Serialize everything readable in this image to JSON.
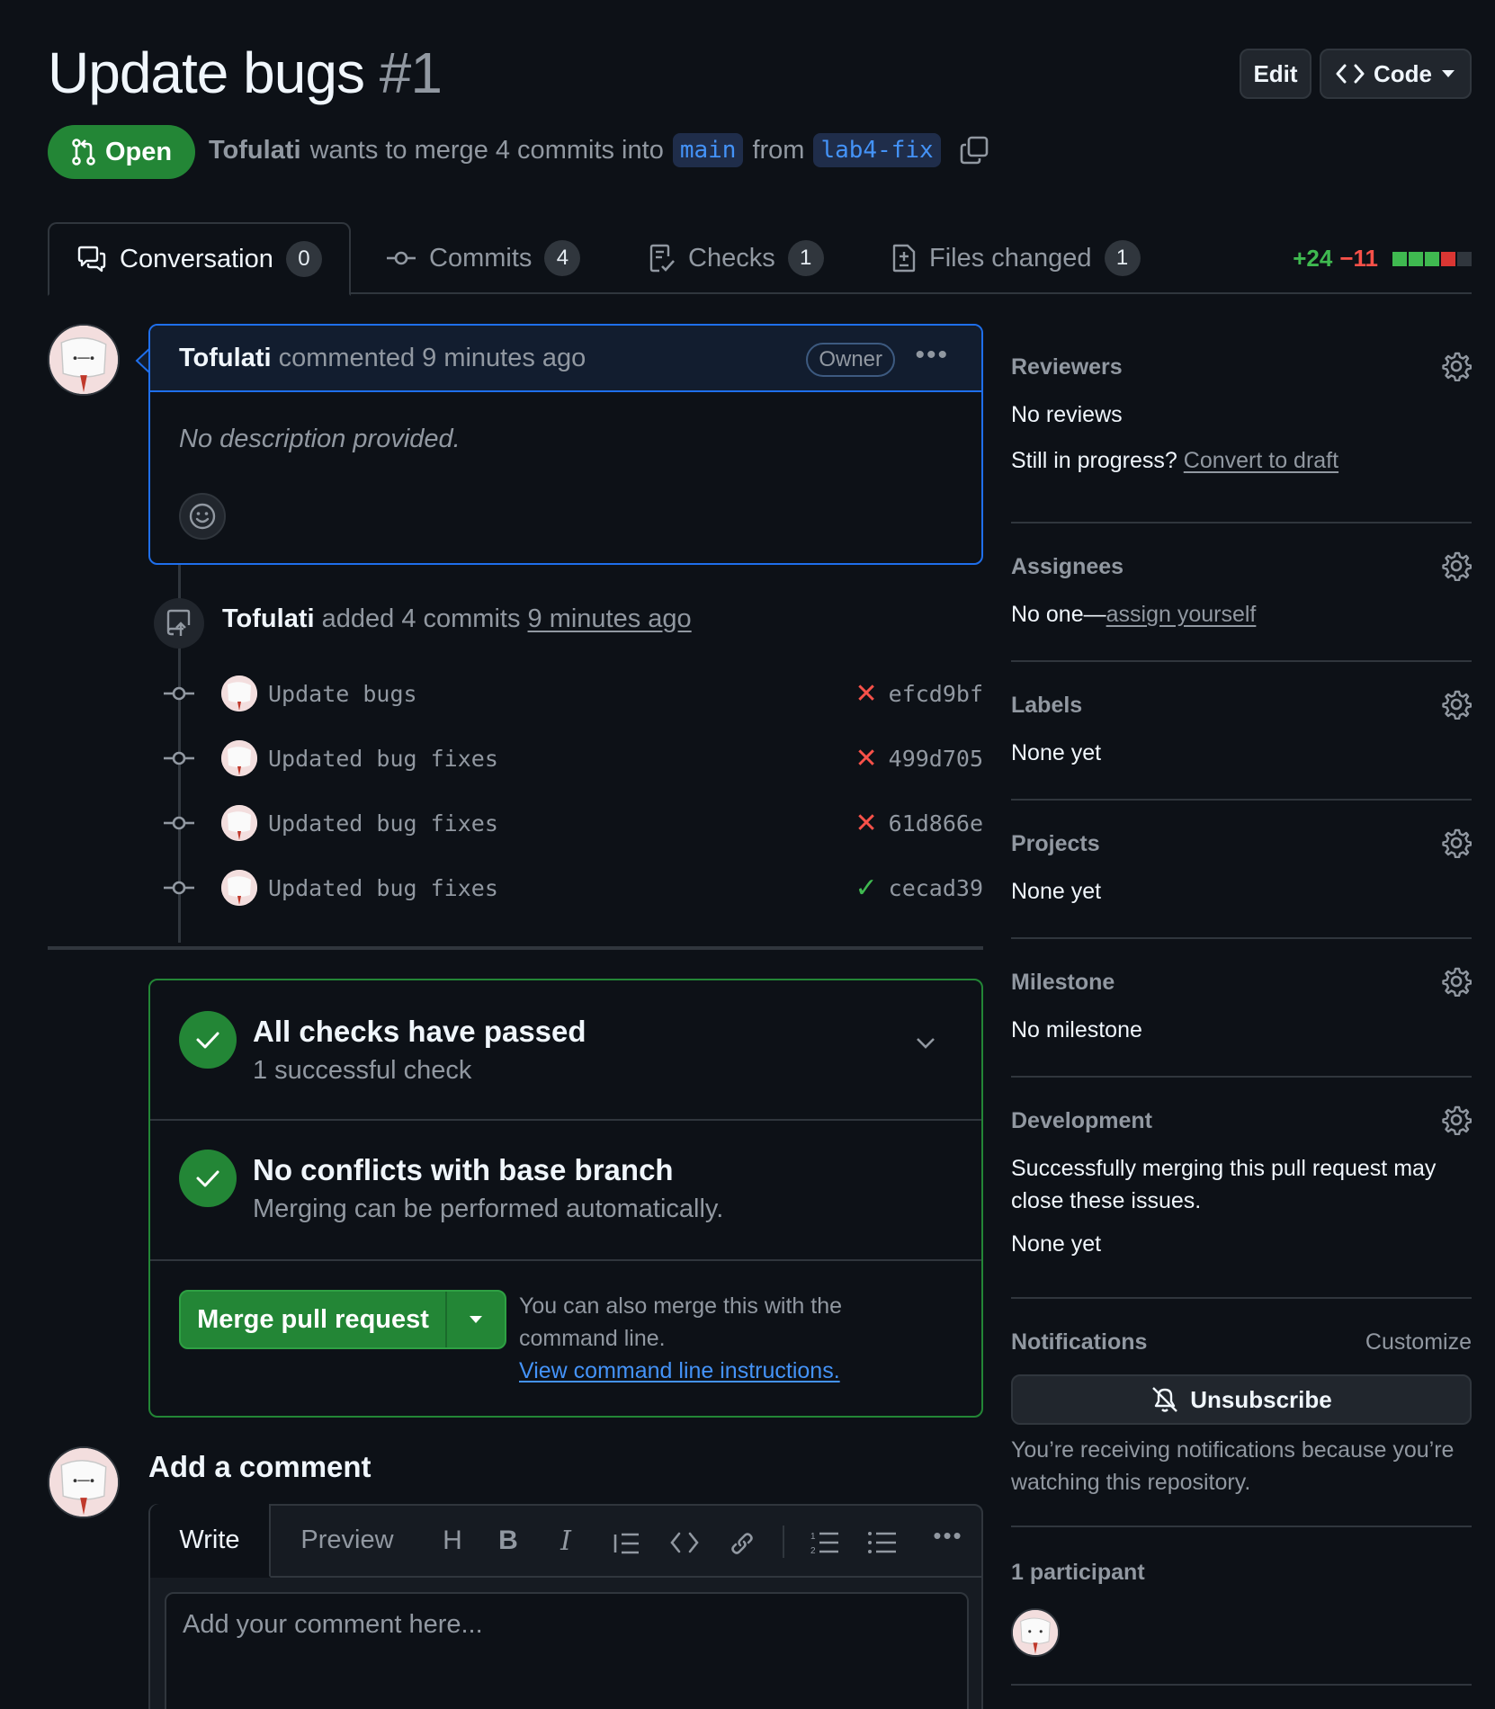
{
  "header": {
    "title": "Update bugs",
    "number": "#1",
    "edit_label": "Edit",
    "code_label": "Code",
    "state": "Open",
    "author": "Tofulati",
    "meta_text": "wants to merge 4 commits into",
    "base_branch": "main",
    "from_text": "from",
    "head_branch": "lab4-fix"
  },
  "tabs": [
    {
      "label": "Conversation",
      "count": "0",
      "icon": "comment-discussion-icon"
    },
    {
      "label": "Commits",
      "count": "4",
      "icon": "git-commit-icon"
    },
    {
      "label": "Checks",
      "count": "1",
      "icon": "checklist-icon"
    },
    {
      "label": "Files changed",
      "count": "1",
      "icon": "file-diff-icon"
    }
  ],
  "diffstat": {
    "additions": "+24",
    "deletions": "−11",
    "blocks": [
      "green",
      "green",
      "green",
      "red",
      "gray"
    ],
    "colors": {
      "green": "#3fb950",
      "red": "#da3633",
      "gray": "#30363d"
    }
  },
  "comment": {
    "author": "Tofulati",
    "action": "commented 9 minutes ago",
    "role": "Owner",
    "body": "No description provided."
  },
  "timeline": {
    "author": "Tofulati",
    "action": "added 4 commits",
    "time": "9 minutes ago",
    "commits": [
      {
        "message": "Update bugs",
        "sha": "efcd9bf",
        "status": "fail"
      },
      {
        "message": "Updated bug fixes",
        "sha": "499d705",
        "status": "fail"
      },
      {
        "message": "Updated bug fixes",
        "sha": "61d866e",
        "status": "fail"
      },
      {
        "message": "Updated bug fixes",
        "sha": "cecad39",
        "status": "pass"
      }
    ]
  },
  "merge": {
    "checks_title": "All checks have passed",
    "checks_sub": "1 successful check",
    "conflicts_title": "No conflicts with base branch",
    "conflicts_sub": "Merging can be performed automatically.",
    "merge_button": "Merge pull request",
    "hint": "You can also merge this with the command line.",
    "hint_link": "View command line instructions."
  },
  "add_comment": {
    "title": "Add a comment",
    "write_tab": "Write",
    "preview_tab": "Preview",
    "placeholder": "Add your comment here..."
  },
  "sidebar": {
    "reviewers": {
      "title": "Reviewers",
      "value": "No reviews",
      "progress_text": "Still in progress?",
      "progress_link": "Convert to draft"
    },
    "assignees": {
      "title": "Assignees",
      "value": "No one—",
      "link": "assign yourself"
    },
    "labels": {
      "title": "Labels",
      "value": "None yet"
    },
    "projects": {
      "title": "Projects",
      "value": "None yet"
    },
    "milestone": {
      "title": "Milestone",
      "value": "No milestone"
    },
    "development": {
      "title": "Development",
      "text": "Successfully merging this pull request may close these issues.",
      "value": "None yet"
    },
    "notifications": {
      "title": "Notifications",
      "customize": "Customize",
      "button": "Unsubscribe",
      "note": "You’re receiving notifications because you’re watching this repository."
    },
    "participants": {
      "title": "1 participant"
    }
  }
}
